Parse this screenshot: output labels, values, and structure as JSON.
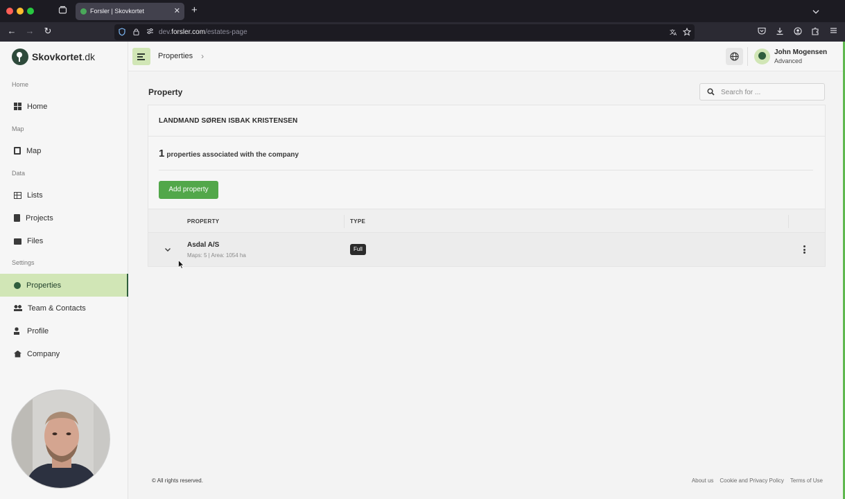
{
  "browser": {
    "tab_title": "Forsler | Skovkortet",
    "url_prefix": "dev.",
    "url_host": "forsler.com",
    "url_path": "/estates-page"
  },
  "sidebar": {
    "logo_name": "Skovkortet",
    "logo_tld": ".dk",
    "sections": {
      "home": "Home",
      "map": "Map",
      "data": "Data",
      "settings": "Settings"
    },
    "items": [
      {
        "label": "Home",
        "icon": "grid-icon"
      },
      {
        "label": "Map",
        "icon": "map-icon"
      },
      {
        "label": "Lists",
        "icon": "table-icon"
      },
      {
        "label": "Projects",
        "icon": "clipboard-icon"
      },
      {
        "label": "Files",
        "icon": "folder-icon"
      },
      {
        "label": "Properties",
        "icon": "properties-icon",
        "active": true
      },
      {
        "label": "Team & Contacts",
        "icon": "team-icon"
      },
      {
        "label": "Profile",
        "icon": "profile-icon"
      },
      {
        "label": "Company",
        "icon": "home-icon"
      }
    ]
  },
  "header": {
    "breadcrumb": "Properties",
    "user_name": "John Mogensen",
    "user_role": "Advanced"
  },
  "main": {
    "page_title": "Property",
    "search_placeholder": "Search for ...",
    "company_name": "LANDMAND SØREN ISBAK KRISTENSEN",
    "property_count": "1",
    "property_count_text": "properties associated with the company",
    "add_button": "Add property",
    "table": {
      "headers": [
        "PROPERTY",
        "TYPE"
      ],
      "rows": [
        {
          "name": "Asdal A/S",
          "meta": "Maps: 5 | Area: 1054 ha",
          "type": "Full"
        }
      ]
    }
  },
  "footer": {
    "copyright": "© All rights reserved.",
    "links": [
      "About us",
      "Cookie and Privacy Policy",
      "Terms of Use"
    ]
  },
  "colors": {
    "accent_green": "#52a74a",
    "active_nav_bg": "#d1e6b6",
    "brand_dark": "#2f5e3d"
  }
}
